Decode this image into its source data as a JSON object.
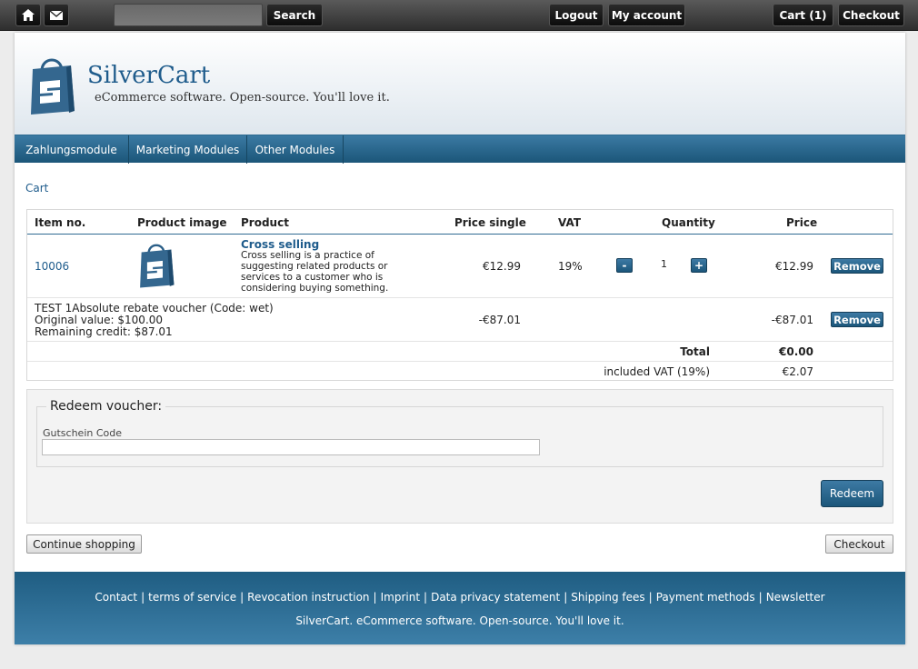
{
  "topbar": {
    "home_icon": "home-icon",
    "mail_icon": "envelope-icon",
    "search_placeholder": "",
    "search_label": "Search",
    "logout_label": "Logout",
    "account_label": "My account",
    "cart_label": "Cart (1)",
    "checkout_label": "Checkout"
  },
  "header": {
    "logo_icon": "shopping-bag-icon",
    "title": "SilverCart",
    "tagline": "eCommerce software. Open-source. You'll love it."
  },
  "nav": {
    "items": [
      {
        "label": "Zahlungsmodule"
      },
      {
        "label": "Marketing Modules"
      },
      {
        "label": "Other Modules"
      }
    ]
  },
  "breadcrumb": "Cart",
  "cart": {
    "headers": {
      "item_no": "Item no.",
      "image": "Product image",
      "product": "Product",
      "price_single": "Price single",
      "vat": "VAT",
      "quantity": "Quantity",
      "price": "Price"
    },
    "item": {
      "item_no": "10006",
      "name": "Cross selling",
      "description": "Cross selling is a practice of suggesting related products or services to a customer who is considering buying something.",
      "price_single": "€12.99",
      "vat": "19%",
      "quantity": "1",
      "minus": "-",
      "plus": "+",
      "price": "€12.99",
      "remove": "Remove"
    },
    "voucher_row": {
      "line1": "TEST 1Absolute rebate voucher (Code: wet)",
      "line2": "Original value: $100.00",
      "line3": "Remaining credit: $87.01",
      "price_single": "-€87.01",
      "price": "-€87.01",
      "remove": "Remove"
    },
    "total_label": "Total",
    "total_value": "€0.00",
    "vat_label": "included VAT (19%)",
    "vat_value": "€2.07"
  },
  "voucher": {
    "legend": "Redeem voucher:",
    "field_label": "Gutschein Code",
    "field_value": "",
    "redeem_label": "Redeem"
  },
  "actions": {
    "continue_label": "Continue shopping",
    "checkout_label": "Checkout"
  },
  "footer": {
    "links": [
      "Contact",
      "terms of service",
      "Revocation instruction",
      "Imprint",
      "Data privacy statement",
      "Shipping fees",
      "Payment methods",
      "Newsletter"
    ],
    "separator": "|",
    "tagline": "SilverCart. eCommerce software. Open-source. You'll love it."
  },
  "colors": {
    "brand": "#1f5c8c",
    "nav_bg": "#1b5679",
    "topbar_bg": "#2e2e2e"
  }
}
